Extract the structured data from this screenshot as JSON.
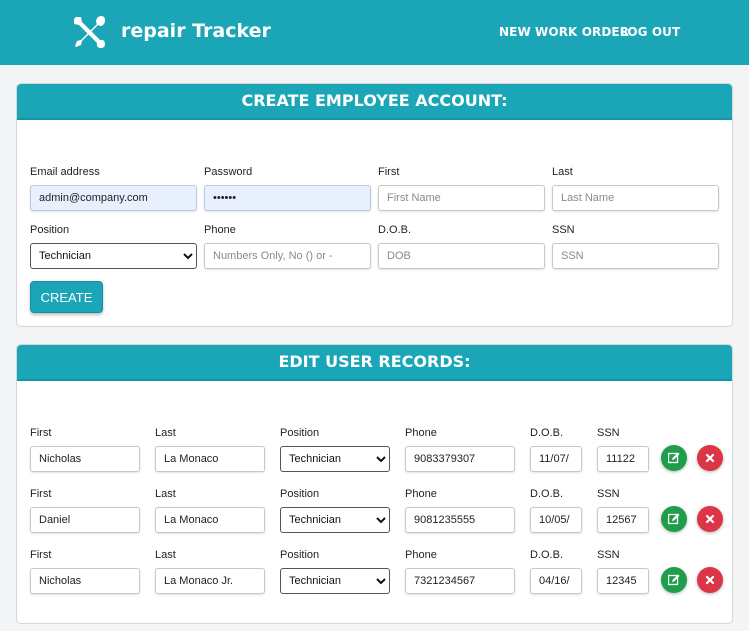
{
  "app": {
    "brand": "repair Tracker",
    "logo_icon": "wrench-screwdriver-icon"
  },
  "nav": {
    "new_work_order": "NEW WORK ORDER",
    "logout": "LOG OUT"
  },
  "create": {
    "title": "CREATE EMPLOYEE ACCOUNT:",
    "labels": {
      "email": "Email address",
      "password": "Password",
      "first": "First",
      "last": "Last",
      "position": "Position",
      "phone": "Phone",
      "dob": "D.O.B.",
      "ssn": "SSN"
    },
    "values": {
      "email": "admin@company.com",
      "password": "••••••",
      "position": "Technician"
    },
    "placeholders": {
      "first": "First Name",
      "last": "Last Name",
      "phone": "Numbers Only, No () or -",
      "dob": "DOB",
      "ssn": "SSN"
    },
    "button": "CREATE"
  },
  "edit": {
    "title": "EDIT USER RECORDS:",
    "labels": {
      "first": "First",
      "last": "Last",
      "position": "Position",
      "phone": "Phone",
      "dob": "D.O.B.",
      "ssn": "SSN"
    },
    "rows": [
      {
        "first": "Nicholas",
        "last": "La Monaco",
        "position": "Technician",
        "phone": "9083379307",
        "dob": "11/07/",
        "ssn": "11122"
      },
      {
        "first": "Daniel",
        "last": "La Monaco",
        "position": "Technician",
        "phone": "9081235555",
        "dob": "10/05/",
        "ssn": "12567"
      },
      {
        "first": "Nicholas",
        "last": "La Monaco Jr.",
        "position": "Technician",
        "phone": "7321234567",
        "dob": "04/16/",
        "ssn": "12345"
      }
    ],
    "edit_icon": "edit-icon",
    "delete_icon": "close-icon"
  },
  "colors": {
    "primary": "#1aa6b7",
    "edit": "#1f9d4a",
    "delete": "#dc3545",
    "autofill": "#e8f0fe"
  }
}
